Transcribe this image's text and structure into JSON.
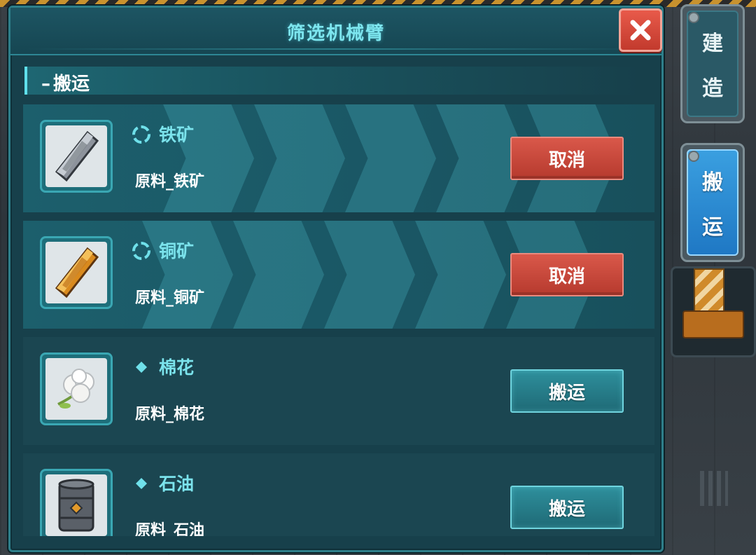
{
  "window": {
    "title": "筛选机械臂",
    "close_icon": "close-icon"
  },
  "section": {
    "dash": "–",
    "label": "搬运"
  },
  "items": [
    {
      "name": "铁矿",
      "desc": "原料_铁矿",
      "status": "loading",
      "icon": "iron-ore-icon",
      "action": "取消",
      "action_type": "cancel"
    },
    {
      "name": "铜矿",
      "desc": "原料_铜矿",
      "status": "loading",
      "icon": "copper-ore-icon",
      "action": "取消",
      "action_type": "cancel"
    },
    {
      "name": "棉花",
      "desc": "原料_棉花",
      "status": "idle",
      "icon": "cotton-icon",
      "action": "搬运",
      "action_type": "carry"
    },
    {
      "name": "石油",
      "desc": "原料_石油",
      "status": "idle",
      "icon": "oil-barrel-icon",
      "action": "搬运",
      "action_type": "carry"
    }
  ],
  "side_tabs": [
    {
      "char1": "建",
      "char2": "造",
      "selected": false
    },
    {
      "char1": "搬",
      "char2": "运",
      "selected": true
    }
  ],
  "colors": {
    "accent": "#7de6ef",
    "cancel": "#c7473a",
    "carry": "#2a8591",
    "panel": "#17404b",
    "selected_tab": "#2a8ad6"
  }
}
